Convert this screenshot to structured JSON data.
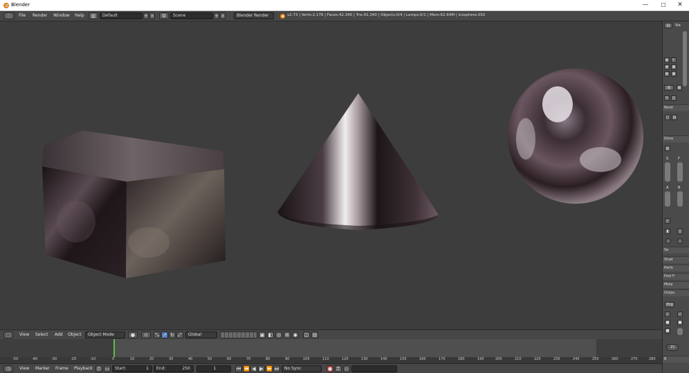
{
  "window": {
    "title": "Blender",
    "minimize": "—",
    "maximize": "☐",
    "close": "✕"
  },
  "infobar": {
    "menus": [
      "File",
      "Render",
      "Window",
      "Help"
    ],
    "screen_layout": "Default",
    "scene": "Scene",
    "render_engine": "Blender Render",
    "stats": "v2.73 | Verts:2,176 | Faces:42,340 | Tris:42,340 | Objects:0/4 | Lamps:0/1 | Mem:62.64M | Icosphere.002"
  },
  "viewport_header": {
    "menus": [
      "View",
      "Select",
      "Add",
      "Object"
    ],
    "mode": "Object Mode",
    "orientation": "Global"
  },
  "timeline": {
    "ticks": [
      "-50",
      "-40",
      "-30",
      "-20",
      "-10",
      "0",
      "10",
      "20",
      "30",
      "40",
      "50",
      "60",
      "70",
      "80",
      "90",
      "100",
      "110",
      "120",
      "130",
      "140",
      "150",
      "160",
      "170",
      "180",
      "190",
      "200",
      "210",
      "220",
      "230",
      "240",
      "250",
      "260",
      "270",
      "280"
    ],
    "menus": [
      "View",
      "Marker",
      "Frame",
      "Playback"
    ],
    "start_label": "Start:",
    "start_value": "1",
    "end_label": "End:",
    "end_value": "250",
    "current_frame": "1",
    "sync": "No Sync"
  },
  "properties": {
    "header_label": "Vie",
    "panels": [
      "Rend",
      "Dime",
      "S",
      "F",
      "A",
      "B",
      "Sa",
      "Shad",
      "Perfo",
      "Post P",
      "Meta",
      "Outpu"
    ],
    "sample_value": "15",
    "png_label": "Png"
  },
  "colors": {
    "viewport_bg": "#3d3d3d",
    "header_bg": "#474747",
    "frame_line": "#60c040"
  }
}
